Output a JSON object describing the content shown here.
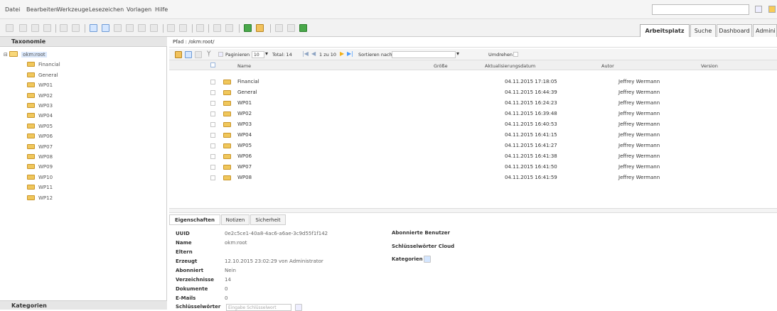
{
  "menu": [
    "Datei",
    "Bearbeiten",
    "Werkzeuge",
    "Lesezeichen",
    "Vorlagen",
    "Hilfe"
  ],
  "tabs": [
    "Arbeitsplatz",
    "Suche",
    "Dashboard",
    "Admini"
  ],
  "left": {
    "title": "Taxonomie",
    "root": "okm:root",
    "folders": [
      "Financial",
      "General",
      "WP01",
      "WP02",
      "WP03",
      "WP04",
      "WP05",
      "WP06",
      "WP07",
      "WP08",
      "WP09",
      "WP10",
      "WP11",
      "WP12"
    ],
    "bottom": "Kategorien"
  },
  "path": {
    "label": "Pfad : /okm:root/"
  },
  "listbar": {
    "paginate": "Paginieren",
    "pagesize": "10",
    "total": "Total: 14",
    "page": "1 zu 10",
    "sort": "Sortieren nach",
    "reverse": "Umdrehen"
  },
  "headers": {
    "name": "Name",
    "size": "Größe",
    "date": "Aktualisierungsdatum",
    "author": "Autor",
    "version": "Version"
  },
  "rows": [
    {
      "name": "Financial",
      "date": "04.11.2015 17:18:05",
      "author": "Jeffrey Wermann"
    },
    {
      "name": "General",
      "date": "04.11.2015 16:44:39",
      "author": "Jeffrey Wermann"
    },
    {
      "name": "WP01",
      "date": "04.11.2015 16:24:23",
      "author": "Jeffrey Wermann"
    },
    {
      "name": "WP02",
      "date": "04.11.2015 16:39:48",
      "author": "Jeffrey Wermann"
    },
    {
      "name": "WP03",
      "date": "04.11.2015 16:40:53",
      "author": "Jeffrey Wermann"
    },
    {
      "name": "WP04",
      "date": "04.11.2015 16:41:15",
      "author": "Jeffrey Wermann"
    },
    {
      "name": "WP05",
      "date": "04.11.2015 16:41:27",
      "author": "Jeffrey Wermann"
    },
    {
      "name": "WP06",
      "date": "04.11.2015 16:41:38",
      "author": "Jeffrey Wermann"
    },
    {
      "name": "WP07",
      "date": "04.11.2015 16:41:50",
      "author": "Jeffrey Wermann"
    },
    {
      "name": "WP08",
      "date": "04.11.2015 16:41:59",
      "author": "Jeffrey Wermann"
    }
  ],
  "props": {
    "tabs": [
      "Eigenschaften",
      "Notizen",
      "Sicherheit"
    ],
    "uuid_label": "UUID",
    "uuid": "0e2c5ce1-40a8-4ac6-a6ae-3c9d55f1f142",
    "name_label": "Name",
    "name": "okm:root",
    "parent_label": "Eltern",
    "created_label": "Erzeugt",
    "created": "12.10.2015 23:02:29 von Administrator",
    "subscribed_label": "Abonniert",
    "subscribed": "Nein",
    "dirs_label": "Verzeichnisse",
    "dirs": "14",
    "docs_label": "Dokumente",
    "docs": "0",
    "mails_label": "E-Mails",
    "mails": "0",
    "keywords_label": "Schlüsselwörter",
    "keywords_placeholder": "Eingabe Schlüsselwort",
    "subscribed_users": "Abonnierte Benutzer",
    "keyword_cloud": "Schlüsselwörter Cloud",
    "categories": "Kategorien"
  }
}
